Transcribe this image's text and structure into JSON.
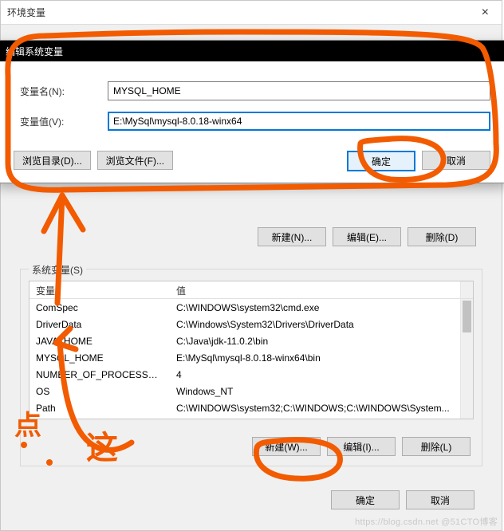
{
  "parent_dialog": {
    "title": "环境变量",
    "close": "×",
    "upper_buttons": {
      "new": "新建(N)...",
      "edit": "编辑(E)...",
      "delete": "删除(D)"
    },
    "group_title": "系统变量(S)",
    "columns": {
      "var": "变量",
      "val": "值"
    },
    "rows": [
      {
        "var": "ComSpec",
        "val": "C:\\WINDOWS\\system32\\cmd.exe"
      },
      {
        "var": "DriverData",
        "val": "C:\\Windows\\System32\\Drivers\\DriverData"
      },
      {
        "var": "JAVA_HOME",
        "val": "C:\\Java\\jdk-11.0.2\\bin"
      },
      {
        "var": "MYSQL_HOME",
        "val": "E:\\MySql\\mysql-8.0.18-winx64\\bin"
      },
      {
        "var": "NUMBER_OF_PROCESSORS",
        "val": "4"
      },
      {
        "var": "OS",
        "val": "Windows_NT"
      },
      {
        "var": "Path",
        "val": "C:\\WINDOWS\\system32;C:\\WINDOWS;C:\\WINDOWS\\System..."
      }
    ],
    "lower_buttons": {
      "new": "新建(W)...",
      "edit": "编辑(I)...",
      "delete": "删除(L)"
    },
    "dialog_buttons": {
      "ok": "确定",
      "cancel": "取消"
    }
  },
  "edit_dialog": {
    "title": "编辑系统变量",
    "name_label": "变量名(N):",
    "name_value": "MYSQL_HOME",
    "value_label": "变量值(V):",
    "value_value": "E:\\MySql\\mysql-8.0.18-winx64",
    "browse_dir": "浏览目录(D)...",
    "browse_file": "浏览文件(F)...",
    "ok": "确定",
    "cancel": "取消"
  },
  "annotation": {
    "color": "#f25b00",
    "text": "点 这"
  },
  "watermark": "https://blog.csdn.net  @51CTO博客"
}
